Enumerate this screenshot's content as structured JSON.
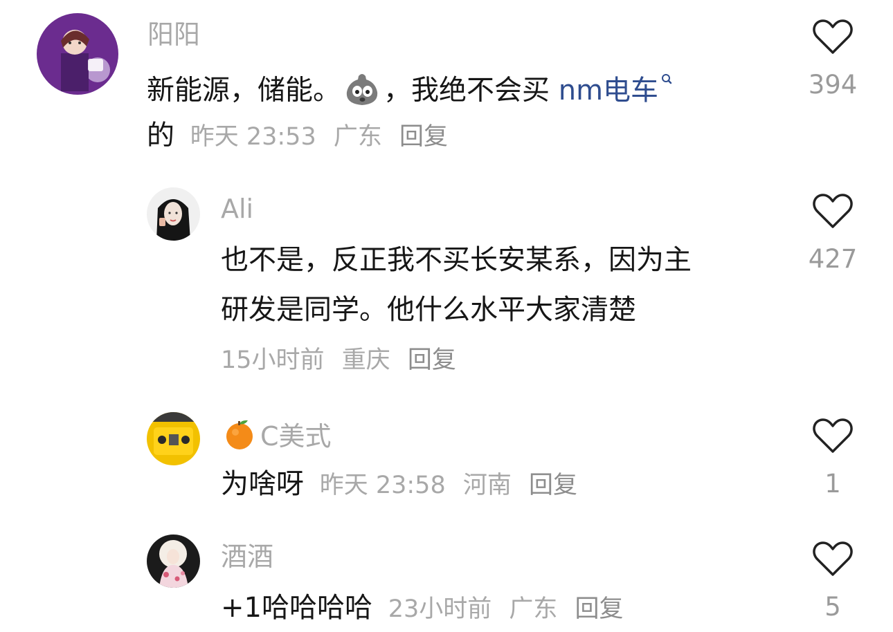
{
  "comments": [
    {
      "username": "阳阳",
      "text_part1": "新能源，储能。",
      "text_part2": "，我绝不会买 ",
      "link_text": "nm电车",
      "text_line2": "的",
      "time": "昨天 23:53",
      "location": "广东",
      "reply": "回复",
      "likes": "394",
      "emoji_icon": "frightened-face-emoji-icon"
    },
    {
      "username": "Ali",
      "text_line1": "也不是，反正我不买长安某系，因为主",
      "text_line2": "研发是同学。他什么水平大家清楚",
      "time": "15小时前",
      "location": "重庆",
      "reply": "回复",
      "likes": "427"
    },
    {
      "username": "C美式",
      "badge_icon": "orange-emoji-icon",
      "text": "为啥呀",
      "time": "昨天 23:58",
      "location": "河南",
      "reply": "回复",
      "likes": "1"
    },
    {
      "username": "酒酒",
      "text": "+1哈哈哈哈",
      "time": "23小时前",
      "location": "广东",
      "reply": "回复",
      "likes": "5"
    }
  ],
  "colors": {
    "username": "#a8a8a8",
    "content": "#161616",
    "link": "#2f4d8f",
    "meta": "#a8a8a8",
    "like_icon": "#222222"
  }
}
